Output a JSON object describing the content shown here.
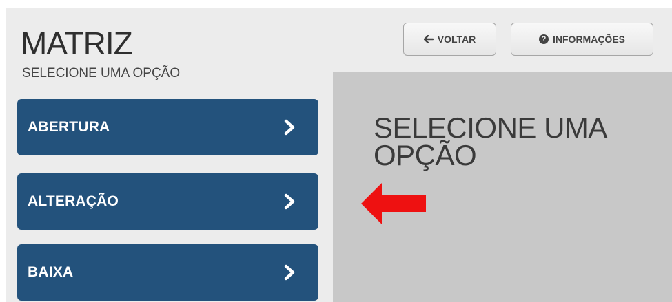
{
  "header": {
    "title": "MATRIZ",
    "subtitle": "SELECIONE UMA OPÇÃO"
  },
  "toolbar": {
    "back_label": "VOLTAR",
    "info_label": "INFORMAÇÕES"
  },
  "menu": {
    "items": [
      {
        "label": "ABERTURA"
      },
      {
        "label": "ALTERAÇÃO"
      },
      {
        "label": "BAIXA"
      }
    ]
  },
  "panel": {
    "message": "SELECIONE UMA OPÇÃO"
  },
  "colors": {
    "menu_bg": "#23527c",
    "panel_bg": "#c8c8c8",
    "page_bg": "#ececec",
    "annotation_arrow": "#ee1111"
  },
  "icons": {
    "back": "arrow-left-icon",
    "info": "question-circle-icon",
    "menu_item": "chevron-right-icon",
    "annotation": "red-arrow-left-icon"
  }
}
